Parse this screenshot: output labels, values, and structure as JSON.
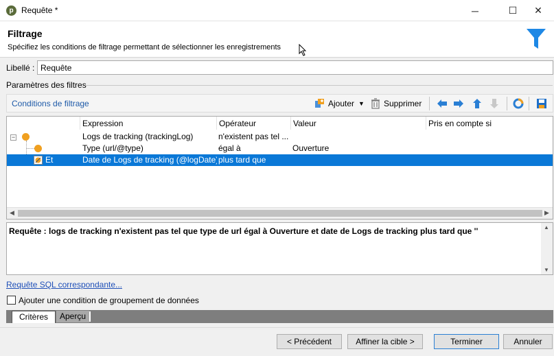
{
  "window": {
    "title": "Requête *",
    "app_icon_glyph": "p",
    "minimize": "─",
    "maximize": "☐",
    "close": "✕"
  },
  "header": {
    "title": "Filtrage",
    "subtitle": "Spécifiez les conditions de filtrage permettant de sélectionner les enregistrements",
    "icon": "funnel-icon",
    "accent_color": "#1e88e5"
  },
  "libelle": {
    "label": "Libellé :",
    "value": "Requête"
  },
  "filters_group": {
    "title": "Paramètres des filtres"
  },
  "toolbar": {
    "title": "Conditions de filtrage",
    "add_label": "Ajouter",
    "delete_label": "Supprimer"
  },
  "grid": {
    "columns": [
      "Expression",
      "Opérateur",
      "Valeur",
      "Pris en compte si"
    ],
    "rows": [
      {
        "prefix": "",
        "expression": "Logs de tracking (trackingLog)",
        "operator": "n'existent pas tel ...",
        "value": "",
        "condition": ""
      },
      {
        "prefix": "",
        "expression": "Type (url/@type)",
        "operator": "égal à",
        "value": "Ouverture",
        "condition": ""
      },
      {
        "prefix": "Et",
        "expression": "Date de Logs de tracking (@logDate)",
        "operator": "plus tard que",
        "value": "",
        "condition": ""
      }
    ],
    "selected_color": "#0a78d7"
  },
  "query_text": "Requête : logs de tracking n'existent pas tel que type de url égal à Ouverture et date de Logs de tracking plus tard que ''",
  "sql_link": "Requête SQL correspondante...",
  "group_checkbox": {
    "label": "Ajouter une condition de groupement de données",
    "checked": false
  },
  "tabs": [
    "Critères",
    "Aperçu"
  ],
  "buttons": {
    "previous": "< Précédent",
    "refine": "Affiner la cible >",
    "finish": "Terminer",
    "cancel": "Annuler"
  }
}
